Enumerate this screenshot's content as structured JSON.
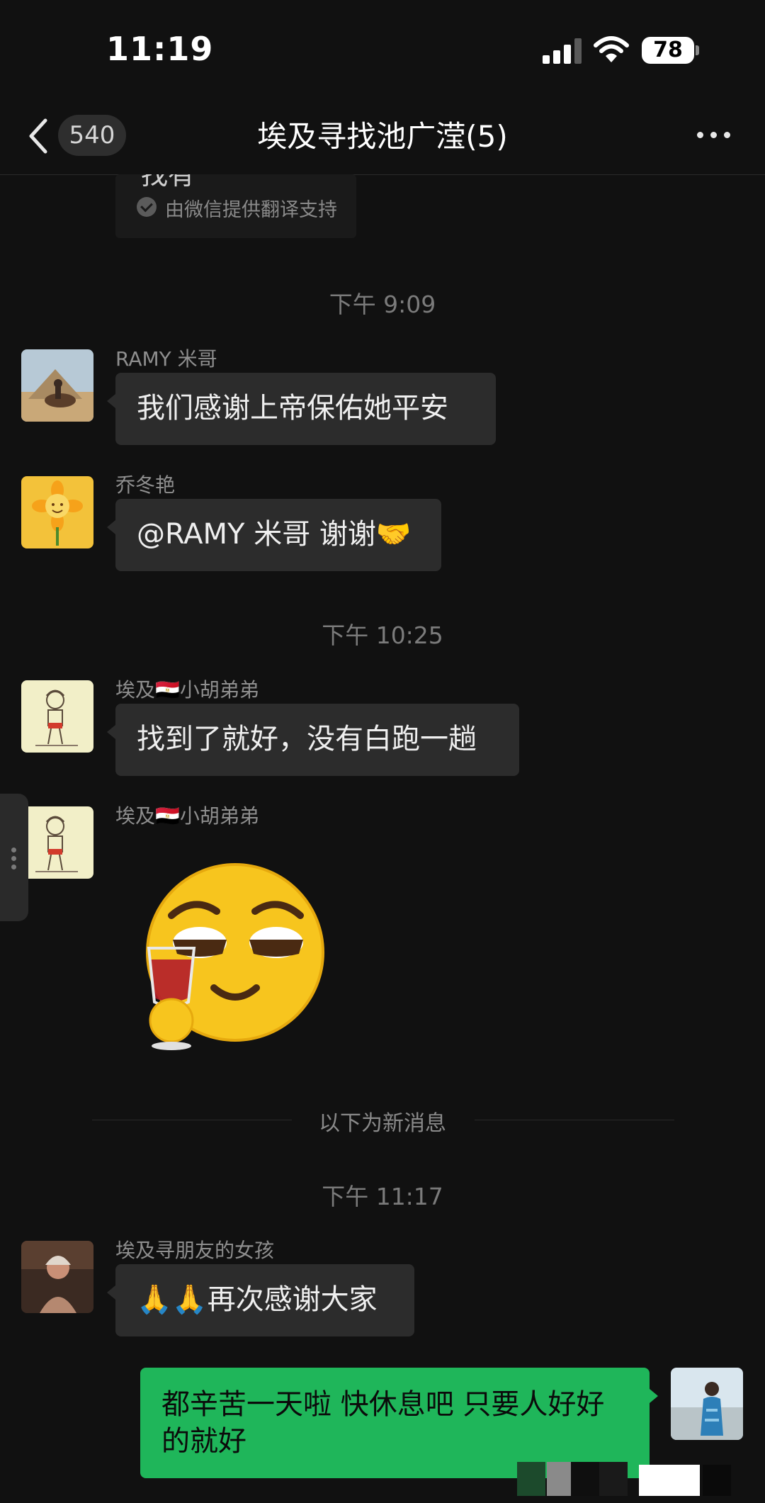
{
  "status_bar": {
    "time": "11:19",
    "battery": "78"
  },
  "header": {
    "back_badge": "540",
    "title": "埃及寻找池广滢(5)"
  },
  "partial_message": {
    "text": "找有",
    "translate_note": "由微信提供翻译支持"
  },
  "timestamps": [
    "下午 9:09",
    "下午 10:25",
    "下午 11:17"
  ],
  "messages": [
    {
      "sender": "RAMY 米哥",
      "text": "我们感谢上帝保佑她平安"
    },
    {
      "sender": "乔冬艳",
      "text": "@RAMY 米哥 谢谢🤝"
    },
    {
      "sender": "埃及🇪🇬小胡弟弟",
      "text": "找到了就好，没有白跑一趟"
    },
    {
      "sender": "埃及🇪🇬小胡弟弟",
      "sticker": "cheers-emoji-sticker"
    },
    {
      "sender": "埃及寻朋友的女孩",
      "text": "🙏🙏再次感谢大家"
    },
    {
      "sender": "me",
      "text": "都辛苦一天啦 快休息吧 只要人好好的就好"
    }
  ],
  "new_messages_divider": "以下为新消息",
  "colors": {
    "background": "#111111",
    "bubble_other": "#2c2c2c",
    "bubble_mine": "#1fb65a"
  }
}
